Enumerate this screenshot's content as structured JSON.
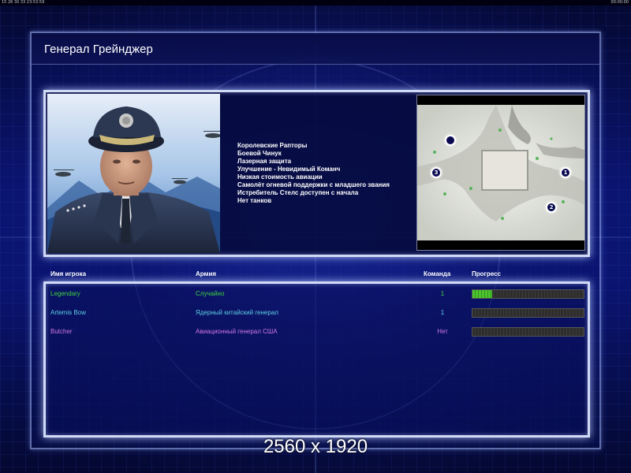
{
  "status_bar": {
    "left_text": "15  26  30  33  23:53:59",
    "right_text": "00:00:00"
  },
  "title": "Генерал Грейнджер",
  "general": {
    "perks": [
      "Королевские Рапторы",
      "Боевой Чинук",
      "Лазерная защита",
      "Улучшение - Невидимый Команч",
      "Низкая стоимость авиации",
      "Самолёт огневой поддержки с младшего звания",
      "Истребитель Стелс доступен с начала",
      "Нет танков"
    ]
  },
  "minimap": {
    "start_positions": [
      "",
      "1",
      "2",
      "3"
    ]
  },
  "table": {
    "headers": {
      "player": "Имя игрока",
      "army": "Армия",
      "team": "Команда",
      "progress": "Прогресс"
    },
    "rows": [
      {
        "player": "Legendary",
        "army": "Случайно",
        "team": "1",
        "progress": 0.18,
        "color": "#3fd43f"
      },
      {
        "player": "Artemis Bow",
        "army": "Ядерный китайский генерал",
        "team": "1",
        "progress": 0,
        "color": "#5fd0e6"
      },
      {
        "player": "Butcher",
        "army": "Авиационный генерал США",
        "team": "Нет",
        "progress": 0,
        "color": "#d277e6"
      }
    ]
  },
  "caption": "2560 x 1920",
  "colors": {
    "background": "#0a1470",
    "panel_border": "#dce6ff",
    "progress_fill": "#4fc62f"
  }
}
